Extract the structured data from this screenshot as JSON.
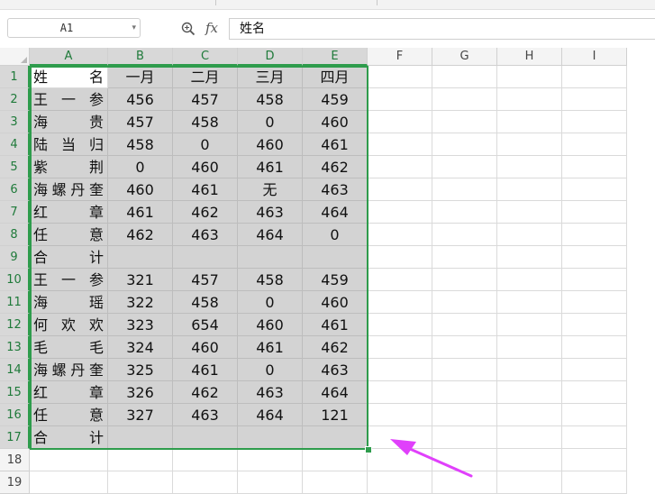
{
  "formula_bar": {
    "name_box": "A1",
    "fx_label": "fx",
    "content": "姓名",
    "icons": {
      "zoom": "zoom-icon",
      "dropdown": "chevron-down-icon"
    }
  },
  "columns": [
    "A",
    "B",
    "C",
    "D",
    "E",
    "F",
    "G",
    "H",
    "I"
  ],
  "rows": [
    "1",
    "2",
    "3",
    "4",
    "5",
    "6",
    "7",
    "8",
    "9",
    "10",
    "11",
    "12",
    "13",
    "14",
    "15",
    "16",
    "17",
    "18",
    "19"
  ],
  "table": {
    "header": [
      "姓名",
      "一月",
      "二月",
      "三月",
      "四月"
    ],
    "body": [
      [
        "王一参",
        "456",
        "457",
        "458",
        "459"
      ],
      [
        "海贵",
        "457",
        "458",
        "0",
        "460"
      ],
      [
        "陆当归",
        "458",
        "0",
        "460",
        "461"
      ],
      [
        "紫荆",
        "0",
        "460",
        "461",
        "462"
      ],
      [
        "海螺丹奎",
        "460",
        "461",
        "无",
        "463"
      ],
      [
        "红章",
        "461",
        "462",
        "463",
        "464"
      ],
      [
        "任意",
        "462",
        "463",
        "464",
        "0"
      ],
      [
        "合计",
        "",
        "",
        "",
        ""
      ],
      [
        "王一参",
        "321",
        "457",
        "458",
        "459"
      ],
      [
        "海瑶",
        "322",
        "458",
        "0",
        "460"
      ],
      [
        "何欢欢",
        "323",
        "654",
        "460",
        "461"
      ],
      [
        "毛毛",
        "324",
        "460",
        "461",
        "462"
      ],
      [
        "海螺丹奎",
        "325",
        "461",
        "0",
        "463"
      ],
      [
        "红章",
        "326",
        "462",
        "463",
        "464"
      ],
      [
        "任意",
        "327",
        "463",
        "464",
        "121"
      ],
      [
        "合计",
        "",
        "",
        "",
        ""
      ]
    ]
  },
  "colors": {
    "selection_border": "#2e9c4c",
    "selection_fill": "#d3d3d3",
    "annotation_arrow": "#e040fb"
  }
}
